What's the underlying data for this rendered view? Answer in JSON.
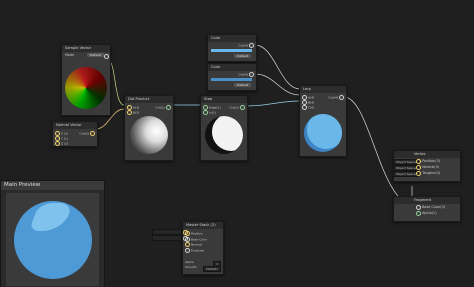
{
  "nodes": {
    "sample_texture": {
      "title": "Sample Texture",
      "rows": [
        "RGBA",
        "R",
        "G",
        "B",
        "A"
      ]
    },
    "color_wheel": {
      "title": "Sample Vector",
      "label": "Mode",
      "value": "Default"
    },
    "normal_vector": {
      "title": "Normal Vector",
      "rows": [
        "X (1)",
        "Y (1)",
        "Z (1)"
      ],
      "output": "Out(3)"
    },
    "dot_product": {
      "title": "Dot Product",
      "inputs": [
        "A(3)",
        "B(3)"
      ],
      "output": "Out(1)"
    },
    "step": {
      "title": "Step",
      "inputs": [
        "Edge(1)",
        "In(1)"
      ],
      "output": "Out(1)"
    },
    "color1": {
      "title": "Color",
      "output": "Out(4)",
      "mode": "Default"
    },
    "color2": {
      "title": "Color",
      "output": "Out(4)",
      "mode": "Default"
    },
    "lerp": {
      "title": "Lerp",
      "inputs": [
        "A(4)",
        "B(4)",
        "T(4)"
      ],
      "output": "Out(4)"
    },
    "master_left": {
      "title": "Master Stack (2)",
      "rows": [
        "Position",
        "Base Color",
        "Normal",
        "Emission"
      ],
      "fields": [
        {
          "label": "Alpha",
          "value": "1"
        },
        {
          "label": "Smooth",
          "value": "Metallic"
        }
      ]
    },
    "vertex": {
      "title": "Vertex",
      "rows": [
        {
          "in": "Object Space",
          "label": "Position(3)"
        },
        {
          "in": "Object Space",
          "label": "Normal(3)"
        },
        {
          "in": "Object Space",
          "label": "Tangent(3)"
        }
      ]
    },
    "fragment": {
      "title": "Fragment",
      "rows": [
        {
          "in": "",
          "label": "Base Color(3)"
        },
        {
          "in": "",
          "label": "Alpha(1)"
        }
      ]
    }
  },
  "main_preview": {
    "title": "Main Preview"
  },
  "colors": {
    "background": "#1f1f1f",
    "node_body": "#3a3a3a",
    "node_header": "#2c2c2c",
    "accent_blue": "#4aa3df",
    "sphere_blue": "#6ab8ea",
    "wire": "#c8c8c8"
  }
}
